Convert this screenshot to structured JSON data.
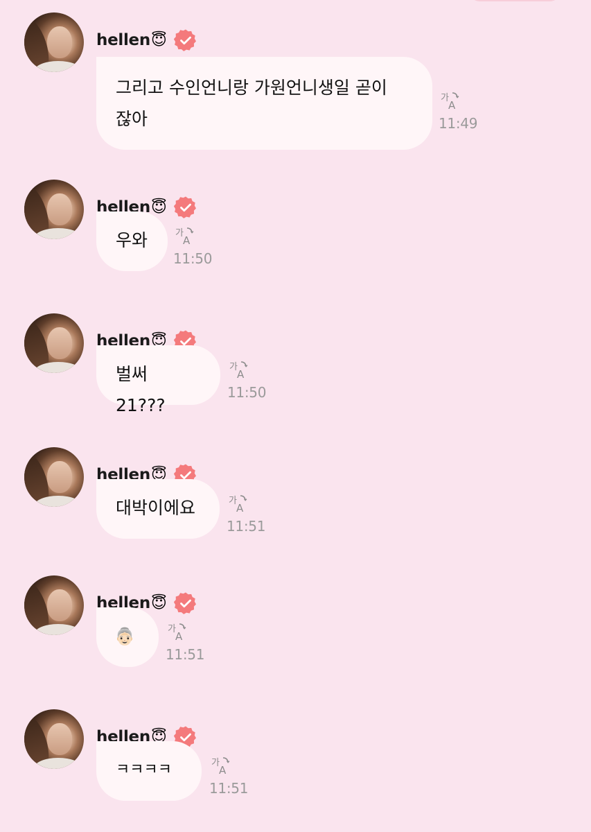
{
  "colors": {
    "background": "#fae4ee",
    "bubble": "#fff6f8",
    "verified_badge": "#f47a7c",
    "timestamp": "#9a9a9a"
  },
  "messages": [
    {
      "sender": "hellen",
      "sender_emoji": "😇",
      "verified": true,
      "text": "그리고 수인언니랑 가원언니생일 곧이 잖아",
      "time": "11:49",
      "translate_icon": "translate-icon"
    },
    {
      "sender": "hellen",
      "sender_emoji": "😇",
      "verified": true,
      "text": "우와",
      "time": "11:50",
      "translate_icon": "translate-icon"
    },
    {
      "sender": "hellen",
      "sender_emoji": "😇",
      "verified": true,
      "text": "벌써 21???",
      "time": "11:50",
      "translate_icon": "translate-icon"
    },
    {
      "sender": "hellen",
      "sender_emoji": "😇",
      "verified": true,
      "text": "대박이에요",
      "time": "11:51",
      "translate_icon": "translate-icon"
    },
    {
      "sender": "hellen",
      "sender_emoji": "😇",
      "verified": true,
      "text": "👵🏻",
      "time": "11:51",
      "translate_icon": "translate-icon"
    },
    {
      "sender": "hellen",
      "sender_emoji": "😇",
      "verified": true,
      "text": "ㅋㅋㅋㅋ",
      "time": "11:51",
      "translate_icon": "translate-icon"
    }
  ]
}
